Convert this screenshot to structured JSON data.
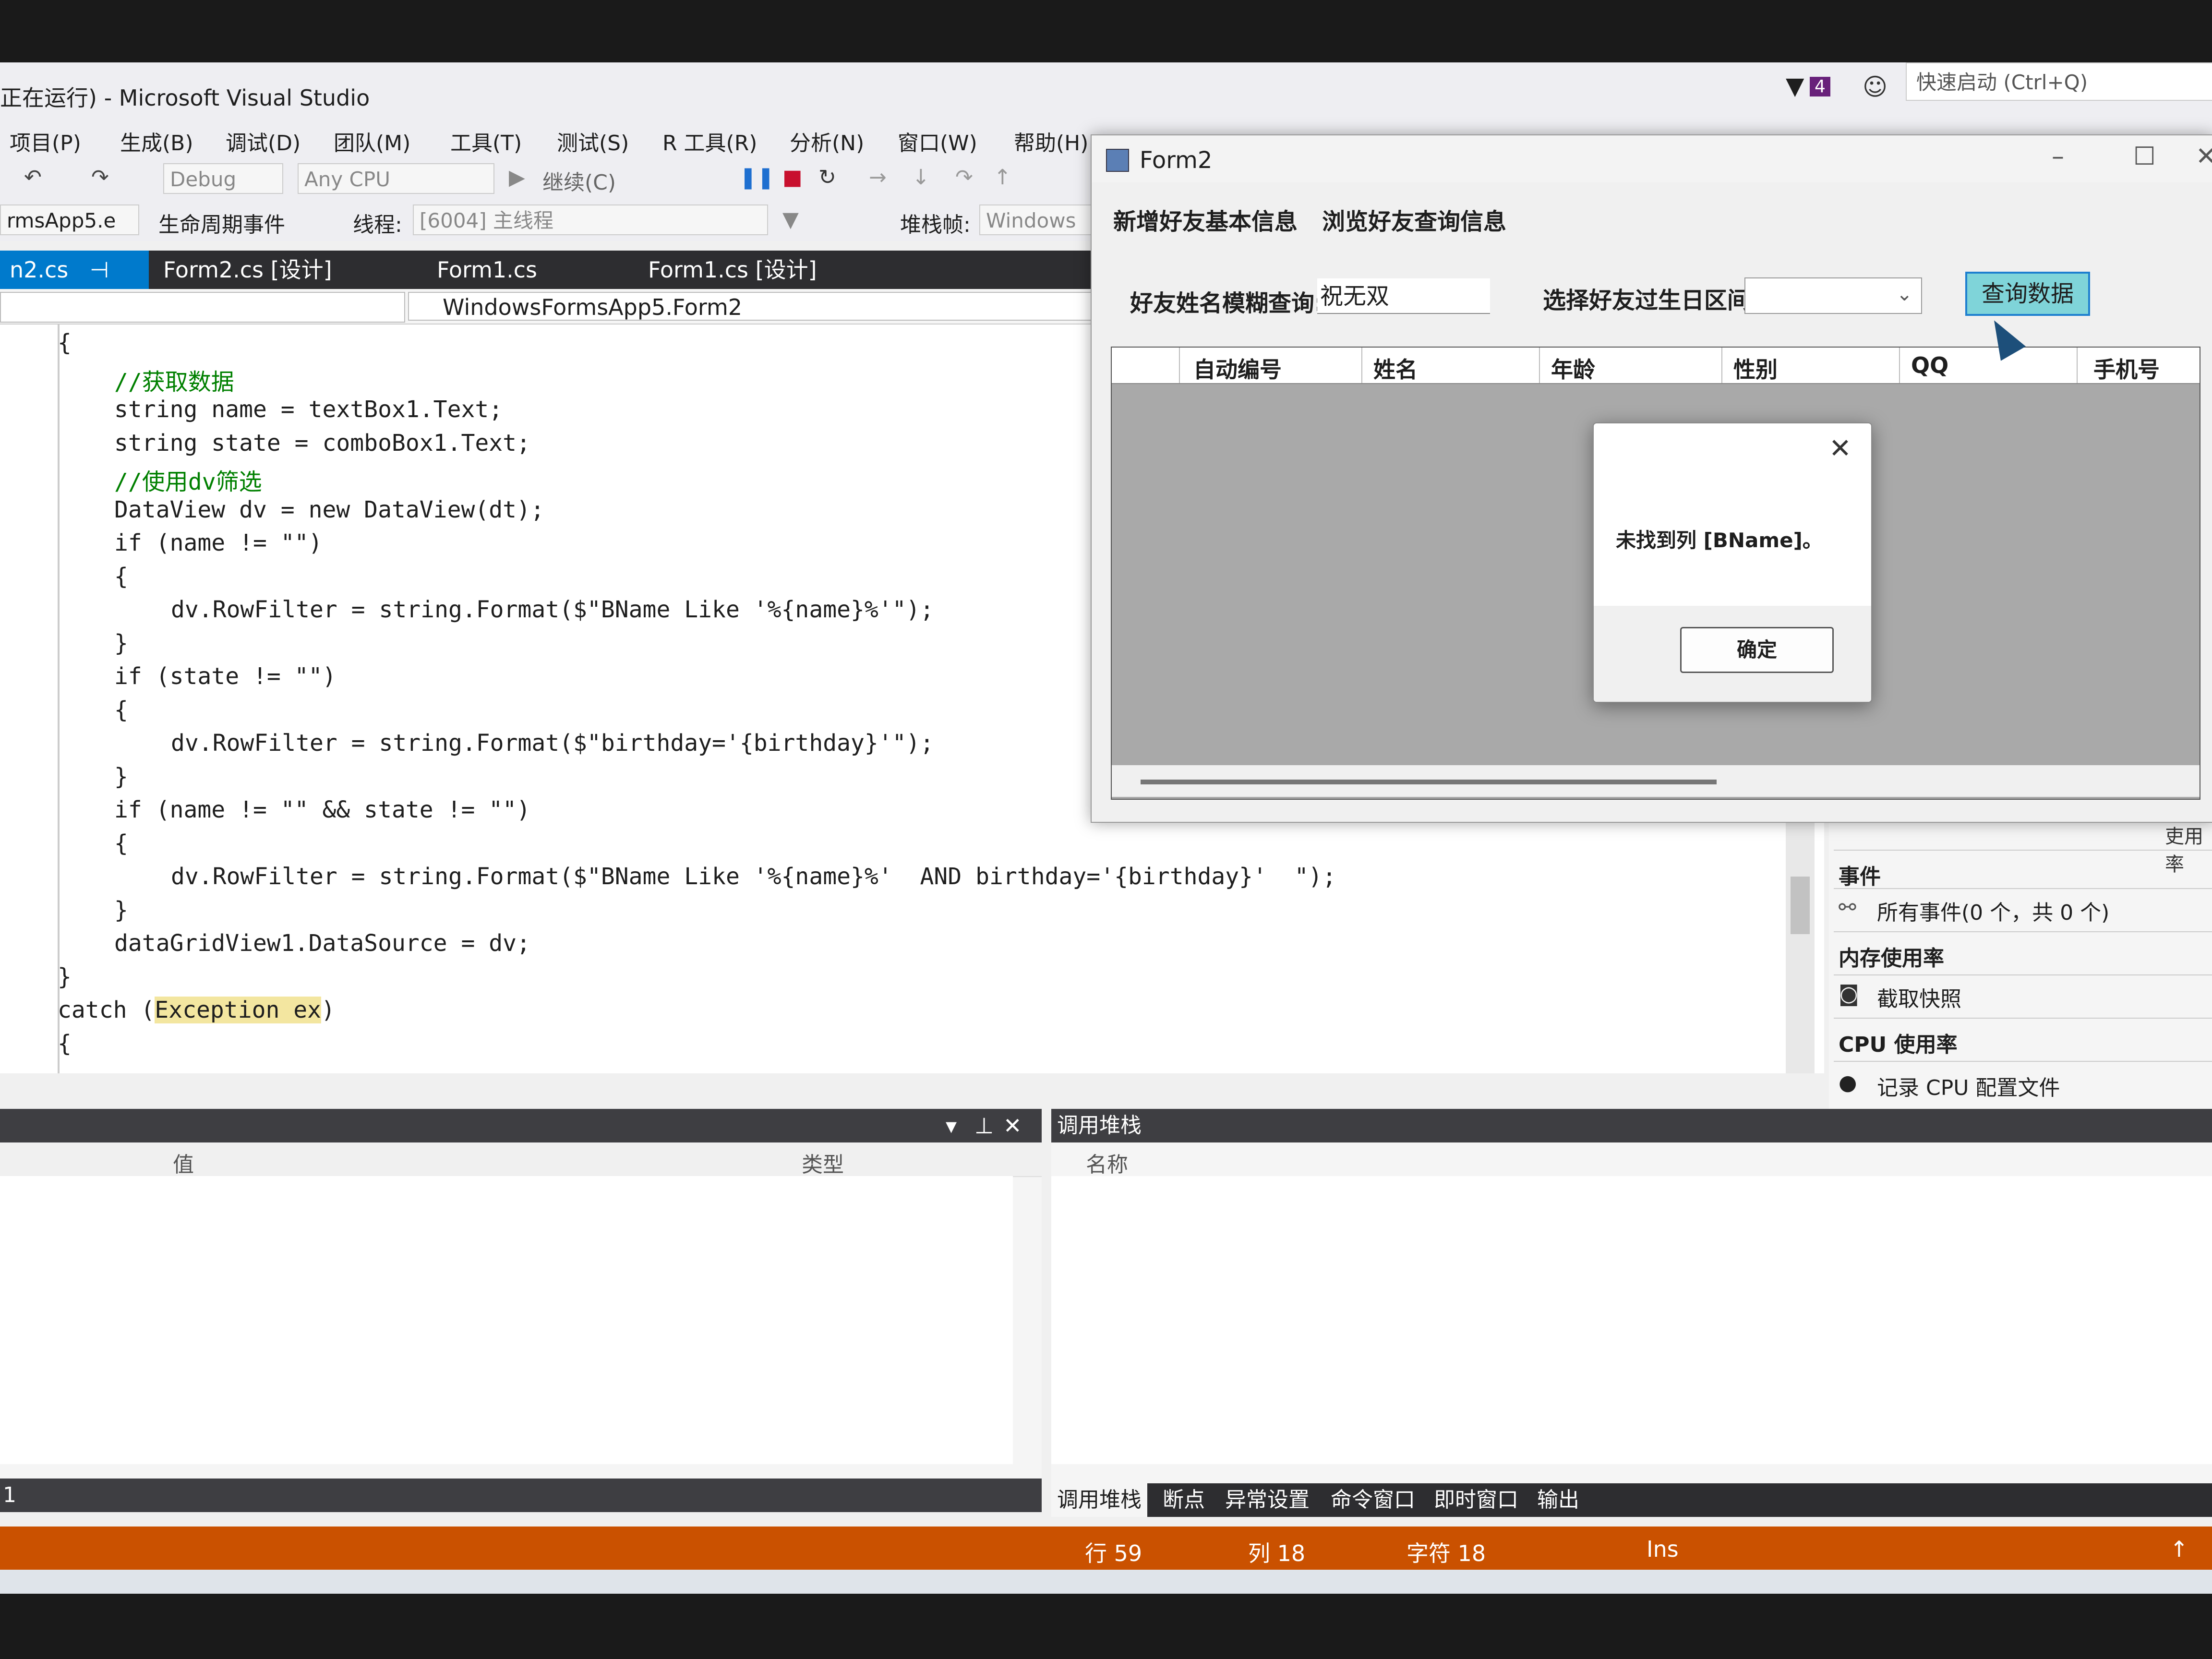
{
  "vs": {
    "title": "正在运行) - Microsoft Visual Studio",
    "filter_badge": "4",
    "quick_launch": "快速启动 (Ctrl+Q)",
    "menu": [
      "项目(P)",
      "生成(B)",
      "调试(D)",
      "团队(M)",
      "工具(T)",
      "测试(S)",
      "R 工具(R)",
      "分析(N)",
      "窗口(W)",
      "帮助(H)"
    ],
    "toolbar": {
      "config": "Debug",
      "platform": "Any CPU",
      "continue": "继续(C)"
    },
    "toolbar2": {
      "process": "rmsApp5.e",
      "lifecycle": "生命周期事件",
      "thread_label": "线程:",
      "thread_value": "[6004] 主线程",
      "stack_label": "堆栈帧:",
      "stack_value": "Windows"
    },
    "doc_tabs": [
      "n2.cs",
      "Form2.cs [设计]",
      "Form1.cs",
      "Form1.cs [设计]"
    ],
    "nav_type": "WindowsFormsApp5.Form2",
    "code_lines": [
      {
        "indent": 2,
        "text": "{",
        "cls": ""
      },
      {
        "indent": 3,
        "text": "//获取数据",
        "cls": "c-com"
      },
      {
        "indent": 3,
        "text": "string name = textBox1.Text;",
        "cls": ""
      },
      {
        "indent": 3,
        "text": "string state = comboBox1.Text;",
        "cls": ""
      },
      {
        "indent": 3,
        "text": "//使用dv筛选",
        "cls": "c-com"
      },
      {
        "indent": 3,
        "text": "DataView dv = new DataView(dt);",
        "cls": ""
      },
      {
        "indent": 3,
        "text": "if (name != \"\")",
        "cls": ""
      },
      {
        "indent": 3,
        "text": "{",
        "cls": ""
      },
      {
        "indent": 4,
        "text": "dv.RowFilter = string.Format($\"BName Like '%{name}%'\");",
        "cls": ""
      },
      {
        "indent": 3,
        "text": "}",
        "cls": ""
      },
      {
        "indent": 3,
        "text": "if (state != \"\")",
        "cls": ""
      },
      {
        "indent": 3,
        "text": "{",
        "cls": ""
      },
      {
        "indent": 4,
        "text": "dv.RowFilter = string.Format($\"birthday='{birthday}'\");",
        "cls": ""
      },
      {
        "indent": 3,
        "text": "}",
        "cls": ""
      },
      {
        "indent": 3,
        "text": "if (name != \"\" && state != \"\")",
        "cls": ""
      },
      {
        "indent": 3,
        "text": "{",
        "cls": ""
      },
      {
        "indent": 4,
        "text": "dv.RowFilter = string.Format($\"BName Like '%{name}%'  AND birthday='{birthday}'  \");",
        "cls": ""
      },
      {
        "indent": 3,
        "text": "}",
        "cls": ""
      },
      {
        "indent": 3,
        "text": "dataGridView1.DataSource = dv;",
        "cls": ""
      },
      {
        "indent": 2,
        "text": "}",
        "cls": ""
      },
      {
        "indent": 2,
        "text": "catch (Exception ex)",
        "cls": ""
      },
      {
        "indent": 2,
        "text": "{",
        "cls": ""
      }
    ],
    "diag": {
      "events_header": "事件",
      "events_row": "所有事件(0 个，共 0 个)",
      "mem_header": "内存使用率",
      "mem_row": "截取快照",
      "cpu_header": "CPU 使用率",
      "cpu_row": "记录 CPU 配置文件",
      "clipped_label": "吏用率"
    },
    "locals": {
      "col_value": "值",
      "col_type": "类型",
      "footer": "1"
    },
    "callstack": {
      "title": "调用堆栈",
      "col_name": "名称"
    },
    "bottom_tabs": [
      "调用堆栈",
      "断点",
      "异常设置",
      "命令窗口",
      "即时窗口",
      "输出"
    ],
    "status": {
      "line": "行 59",
      "col": "列 18",
      "char": "字符 18",
      "mode": "Ins"
    }
  },
  "form2": {
    "title": "Form2",
    "menu": [
      "新增好友基本信息",
      "浏览好友查询信息"
    ],
    "search_label": "好友姓名模糊查询:",
    "search_value": "祝无双",
    "birthday_label": "选择好友过生日区间:",
    "query_button": "查询数据",
    "grid_headers": [
      "自动编号",
      "姓名",
      "年龄",
      "性别",
      "QQ",
      "手机号"
    ]
  },
  "msgbox": {
    "message": "未找到列 [BName]。",
    "ok": "确定"
  },
  "colors": {
    "status_bar": "#ca5100",
    "tab_active": "#007acc",
    "query_button_bg": "#7fd4d9"
  }
}
